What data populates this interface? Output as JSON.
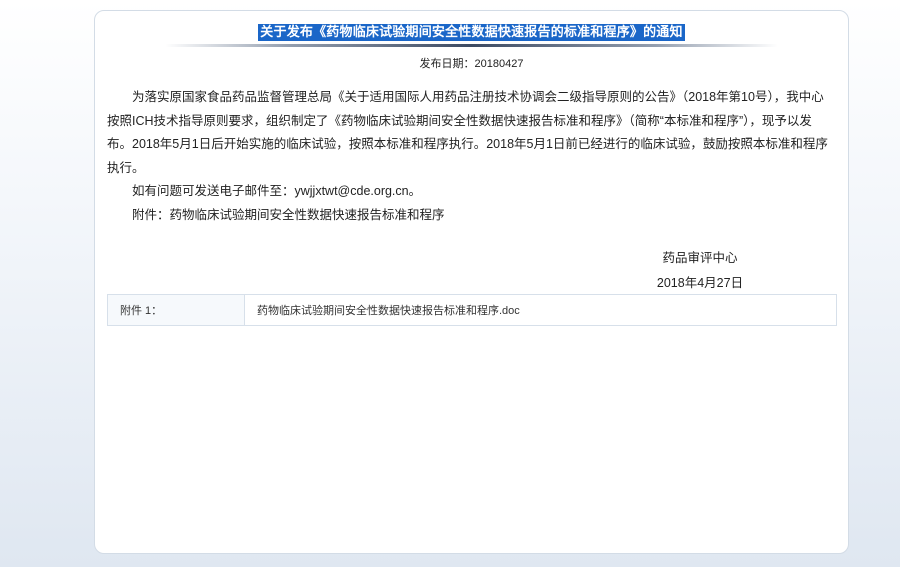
{
  "notice": {
    "title": "关于发布《药物临床试验期间安全性数据快速报告的标准和程序》的通知",
    "date_label": "发布日期：20180427",
    "paragraphs": [
      "为落实原国家食品药品监督管理总局《关于适用国际人用药品注册技术协调会二级指导原则的公告》（2018年第10号），我中心按照ICH技术指导原则要求，组织制定了《药物临床试验期间安全性数据快速报告标准和程序》（简称“本标准和程序”），现予以发布。2018年5月1日后开始实施的临床试验，按照本标准和程序执行。2018年5月1日前已经进行的临床试验，鼓励按照本标准和程序执行。",
      "如有问题可发送电子邮件至：ywjjxtwt@cde.org.cn。",
      "附件：药物临床试验期间安全性数据快速报告标准和程序"
    ],
    "signature_org": "药品审评中心",
    "signature_date": "2018年4月27日"
  },
  "attachment": {
    "label": "附件 1：",
    "file_name": "药物临床试验期间安全性数据快速报告标准和程序.doc"
  }
}
